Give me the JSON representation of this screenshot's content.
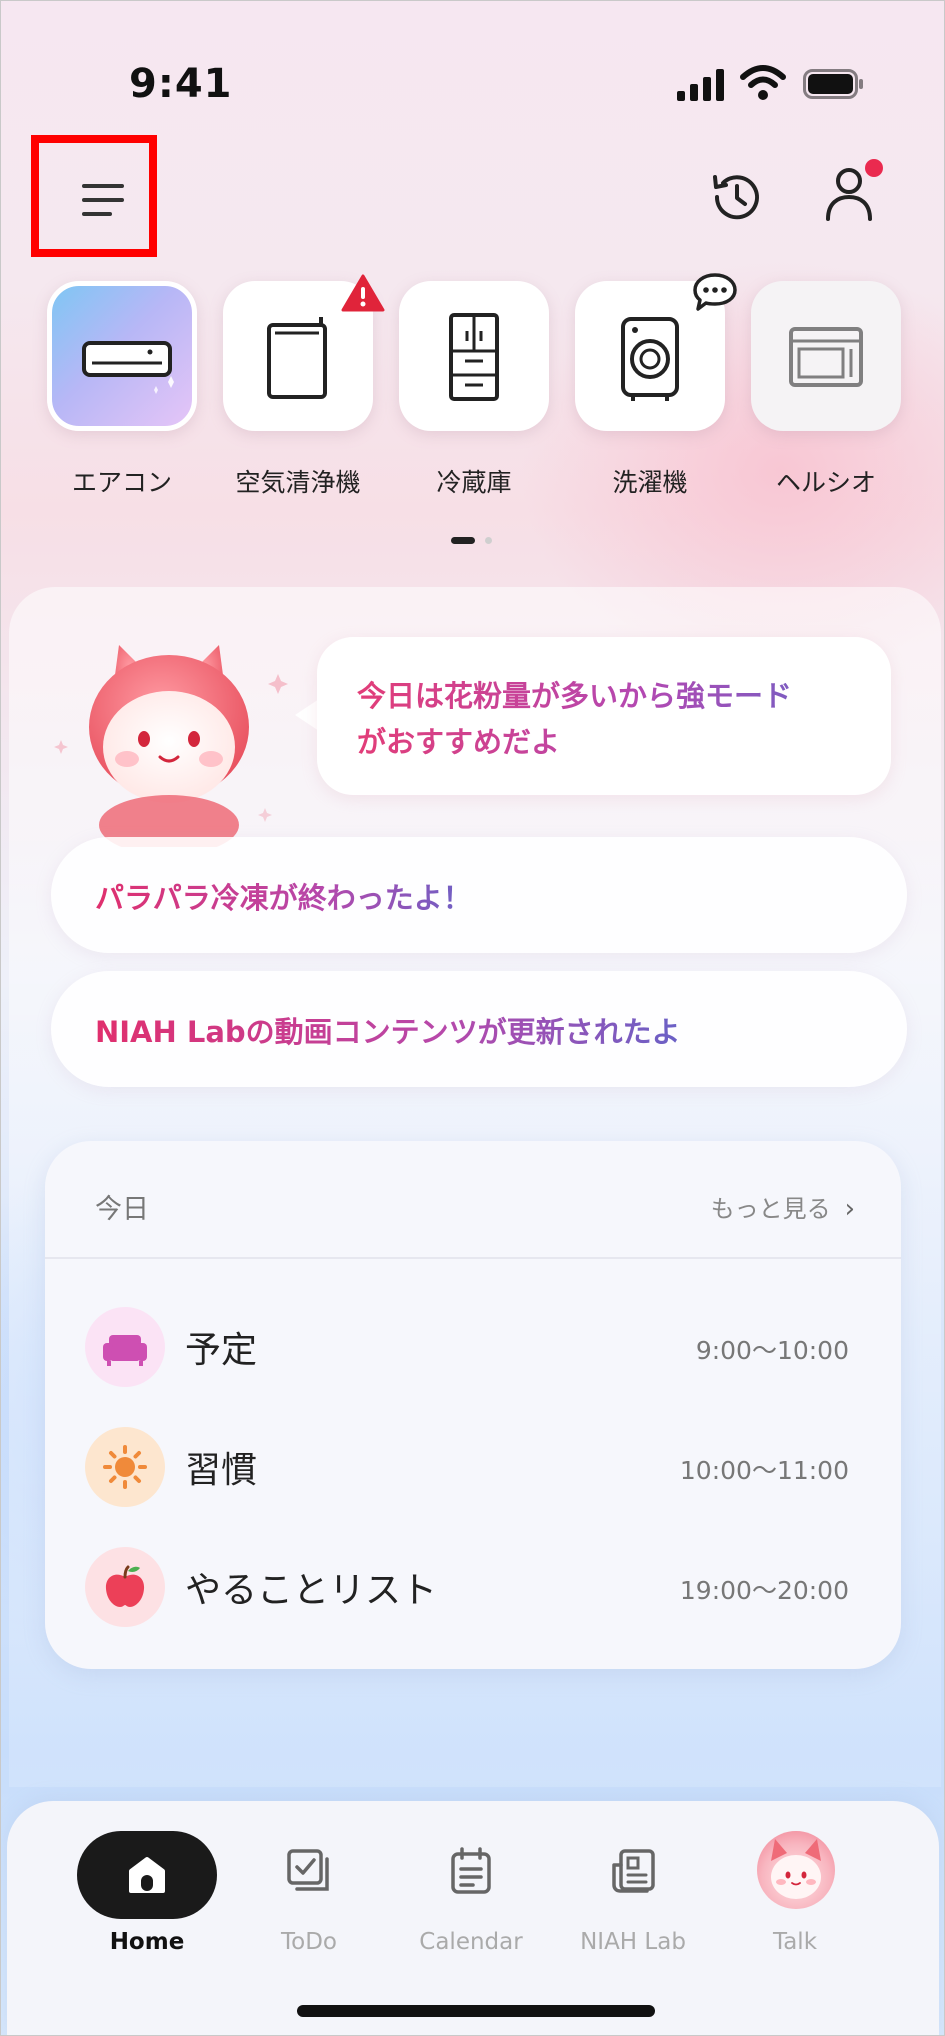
{
  "status_bar": {
    "time": "9:41"
  },
  "header": {
    "menu_icon": "hamburger-menu-icon",
    "history_icon": "history-clock-icon",
    "profile_icon": "person-icon",
    "profile_has_notification": true
  },
  "devices": [
    {
      "label": "エアコン",
      "icon": "air-conditioner-icon",
      "selected": true
    },
    {
      "label": "空気清浄機",
      "icon": "air-purifier-icon",
      "badge": "warning-icon"
    },
    {
      "label": "冷蔵庫",
      "icon": "refrigerator-icon"
    },
    {
      "label": "洗濯機",
      "icon": "washing-machine-icon",
      "badge": "chat-bubble-icon"
    },
    {
      "label": "ヘルシオ",
      "icon": "microwave-oven-icon"
    }
  ],
  "pager": {
    "page": 1,
    "pages": 2
  },
  "assistant": {
    "message_line1": "今日は花粉量が多いから強モード",
    "message_line2": "がおすすめだよ"
  },
  "notices": [
    {
      "text": "パラパラ冷凍が終わったよ！"
    },
    {
      "text": "NIAH Labの動画コンテンツが更新されたよ"
    }
  ],
  "today": {
    "title": "今日",
    "more_label": "もっと見る",
    "items": [
      {
        "label": "予定",
        "time": "9:00〜10:00",
        "icon": "sofa-icon",
        "color": "#ce4fb2"
      },
      {
        "label": "習慣",
        "time": "10:00〜11:00",
        "icon": "sun-icon",
        "color": "#f08a3a"
      },
      {
        "label": "やることリスト",
        "time": "19:00〜20:00",
        "icon": "apple-icon",
        "color": "#ec4058"
      }
    ]
  },
  "tabbar": {
    "tabs": [
      {
        "label": "Home",
        "icon": "home-icon",
        "active": true
      },
      {
        "label": "ToDo",
        "icon": "checklist-icon"
      },
      {
        "label": "Calendar",
        "icon": "calendar-icon"
      },
      {
        "label": "NIAH Lab",
        "icon": "newspaper-icon"
      },
      {
        "label": "Talk",
        "icon": "mascot-avatar-icon"
      }
    ]
  }
}
